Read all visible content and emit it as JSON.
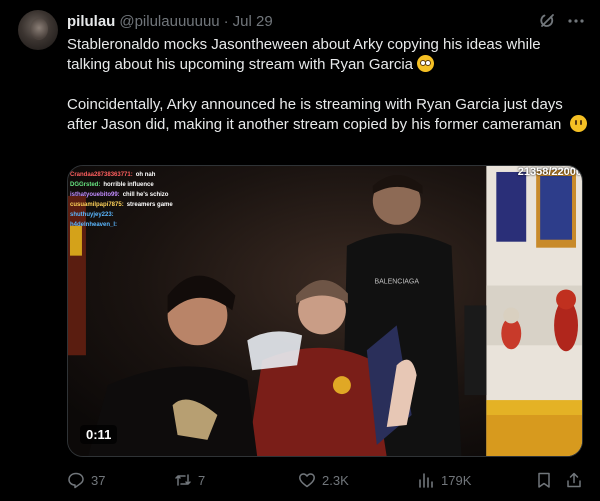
{
  "author": {
    "display_name": "pilulau",
    "handle": "@pilulauuuuuu",
    "separator": "·",
    "date": "Jul 29"
  },
  "tweet": {
    "paragraph1": "Stableronaldo mocks Jasontheween about Arky copying his ideas while talking about his upcoming stream with Ryan Garcia",
    "paragraph2": "Coincidentally, Arky announced he is streaming with Ryan Garcia just days after Jason did, making it another stream copied by his former cameraman"
  },
  "media": {
    "viewer_count": "21358/22000",
    "duration": "0:11",
    "chat": [
      {
        "user": "Crandaa28738363771:",
        "text": "oh nah"
      },
      {
        "user": "DGGrsted:",
        "text": "horrible influence"
      },
      {
        "user": "isthatyouebito99:",
        "text": "chill he's schizo"
      },
      {
        "user": "cusuamilpapi7875:",
        "text": "streamers game"
      },
      {
        "user": "shuthuyjey223:",
        "text": ""
      },
      {
        "user": "h4delnheaven_l:",
        "text": ""
      }
    ],
    "shirt_text": "BALENCIAGA"
  },
  "actions": {
    "replies": "37",
    "reposts": "7",
    "likes": "2.3K",
    "views": "179K"
  },
  "icons": {
    "grok": "grok-icon",
    "more": "more-icon",
    "reply": "reply-icon",
    "repost": "repost-icon",
    "like": "heart-icon",
    "views": "views-icon",
    "bookmark": "bookmark-icon",
    "share": "share-icon"
  },
  "colors": {
    "background": "#000000",
    "text": "#e7e9ea",
    "muted": "#71767b",
    "border": "#2f3336"
  }
}
